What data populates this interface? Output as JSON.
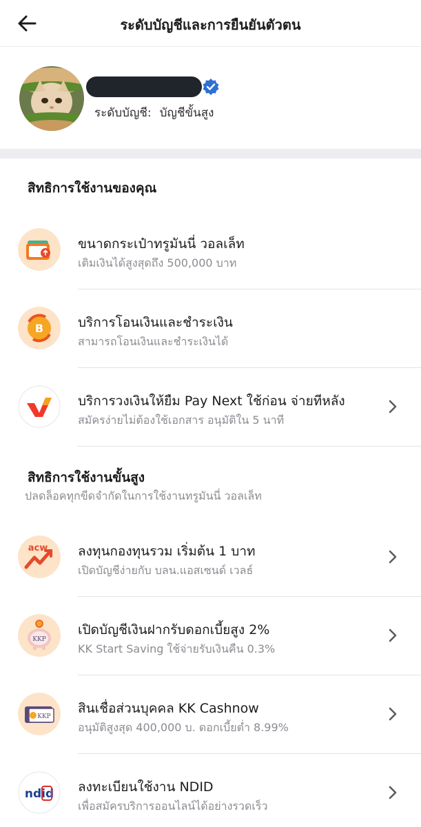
{
  "header": {
    "title": "ระดับบัญชีและการยืนยันตัวตน"
  },
  "profile": {
    "level_label": "ระดับบัญชี:",
    "level_value": "บัญชีขั้นสูง"
  },
  "section_yours": {
    "title": "สิทธิการใช้งานของคุณ",
    "items": [
      {
        "title": "ขนาดกระเป๋าทรูมันนี่ วอลเล็ท",
        "subtitle": "เติมเงินได้สูงสุดถึง 500,000 บาท",
        "icon": "wallet-icon"
      },
      {
        "title": "บริการโอนเงินและชำระเงิน",
        "subtitle": "สามารถโอนเงินและชำระเงินได้",
        "icon": "transfer-coin-icon"
      },
      {
        "title": "บริการวงเงินให้ยืม Pay Next ใช้ก่อน จ่ายทีหลัง",
        "subtitle": "สมัครง่ายไม่ต้องใช้เอกสาร อนุมัติใน 5 นาที",
        "icon": "pay-next-logo"
      }
    ]
  },
  "section_advanced": {
    "title": "สิทธิการใช้งานขั้นสูง",
    "subtitle": "ปลดล็อคทุกขีดจำกัดในการใช้งานทรูมันนี่ วอลเล็ท",
    "items": [
      {
        "title": "ลงทุนกองทุนรวม เริ่มต้น 1 บาท",
        "subtitle": "เปิดบัญชีง่ายกับ บลน.แอสเซนด์ เวลธ์",
        "icon": "acw-logo",
        "logo_text": "acw"
      },
      {
        "title": "เปิดบัญชีเงินฝากรับดอกเบี้ยสูง 2%",
        "subtitle": "KK Start Saving ใช้จ่ายรับเงินคืน 0.3%",
        "icon": "kkp-piggy-icon",
        "logo_text": "KKP"
      },
      {
        "title": "สินเชื่อส่วนบุคคล KK Cashnow",
        "subtitle": "อนุมัติสูงสุด 400,000 บ. ดอกเบี้ยต่ำ 8.99%",
        "icon": "kkp-card-icon",
        "logo_text": "KKP"
      },
      {
        "title": "ลงทะเบียนใช้งาน NDID",
        "subtitle": "เพื่อสมัครบริการออนไลน์ได้อย่างรวดเร็ว",
        "icon": "ndid-logo",
        "logo_text": "ndid"
      }
    ]
  },
  "colors": {
    "verified_blue": "#2f6fd6",
    "orange_accent": "#f47a20",
    "pay_next_red": "#f0392b",
    "ndid_blue": "#1c3f94",
    "ndid_red": "#e02a2a"
  }
}
